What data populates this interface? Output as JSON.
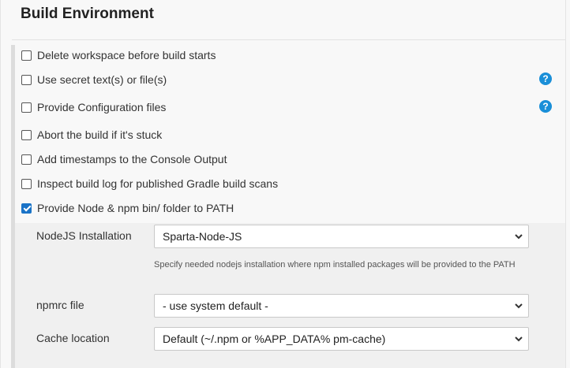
{
  "section": {
    "title": "Build Environment"
  },
  "options": [
    {
      "label": "Delete workspace before build starts",
      "checked": false
    },
    {
      "label": "Use secret text(s) or file(s)",
      "checked": false
    },
    {
      "label": "Provide Configuration files",
      "checked": false
    },
    {
      "label": "Abort the build if it's stuck",
      "checked": false
    },
    {
      "label": "Add timestamps to the Console Output",
      "checked": false
    },
    {
      "label": "Inspect build log for published Gradle build scans",
      "checked": false
    },
    {
      "label": "Provide Node & npm bin/ folder to PATH",
      "checked": true
    }
  ],
  "help": {
    "symbol": "?"
  },
  "node": {
    "installation_label": "NodeJS Installation",
    "installation_value": "Sparta-Node-JS",
    "installation_hint": "Specify needed nodejs installation where npm installed packages will be provided to the PATH",
    "npmrc_label": "npmrc file",
    "npmrc_value": "- use system default -",
    "cache_label": "Cache location",
    "cache_value": "Default (~/.npm or %APP_DATA% pm-cache)"
  },
  "colors": {
    "accent": "#1a73c7",
    "help": "#1a8fd8"
  }
}
